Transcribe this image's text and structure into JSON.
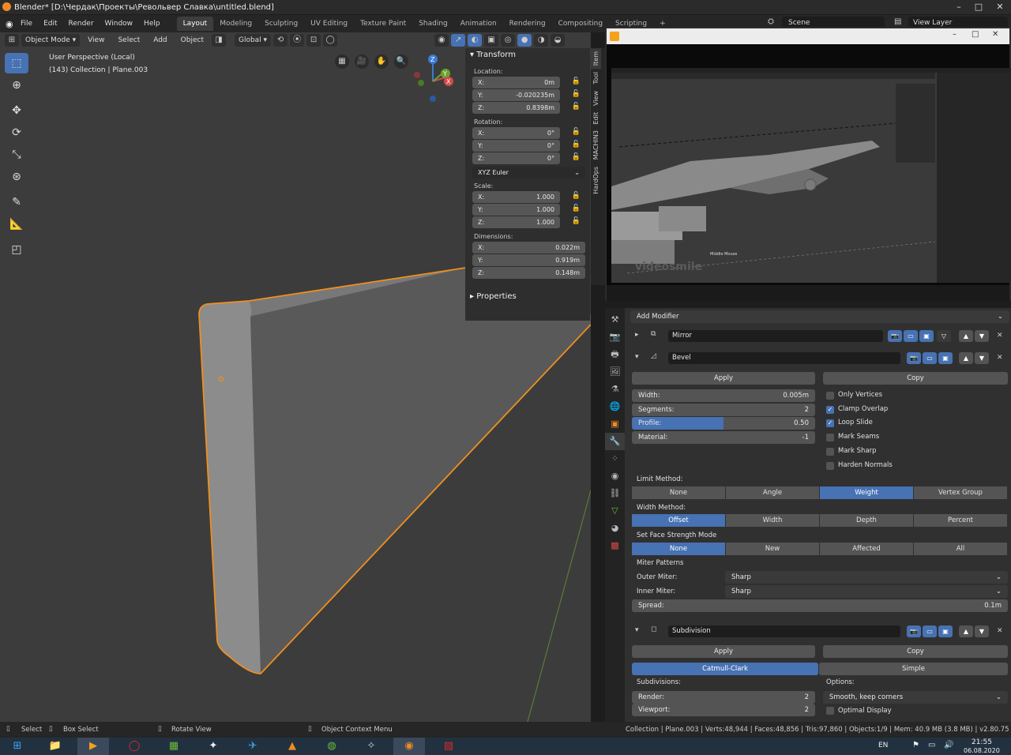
{
  "window": {
    "title": "Blender* [D:\\Чердак\\Проекты\\Револьвер Славка\\untitled.blend]"
  },
  "menu": {
    "items": [
      "File",
      "Edit",
      "Render",
      "Window",
      "Help"
    ]
  },
  "workspaces": [
    "Layout",
    "Modeling",
    "Sculpting",
    "UV Editing",
    "Texture Paint",
    "Shading",
    "Animation",
    "Rendering",
    "Compositing",
    "Scripting"
  ],
  "topright": {
    "scene": "Scene",
    "view_layer": "View Layer"
  },
  "viewport": {
    "mode": "Object Mode",
    "menus": [
      "View",
      "Select",
      "Add",
      "Object"
    ],
    "orientation": "Global",
    "overlay_line1": "User Perspective (Local)",
    "overlay_line2": "(143) Collection | Plane.003",
    "gizmo": {
      "x": "X",
      "y": "Y",
      "z": "Z"
    }
  },
  "npanel": {
    "tabs": [
      "Item",
      "Tool",
      "View",
      "Edit",
      "MACHIN3",
      "HardOps"
    ],
    "transform_title": "Transform",
    "location_label": "Location:",
    "location": [
      {
        "axis": "X:",
        "value": "0m"
      },
      {
        "axis": "Y:",
        "value": "-0.020235m"
      },
      {
        "axis": "Z:",
        "value": "0.8398m"
      }
    ],
    "rotation_label": "Rotation:",
    "rotation": [
      {
        "axis": "X:",
        "value": "0°"
      },
      {
        "axis": "Y:",
        "value": "0°"
      },
      {
        "axis": "Z:",
        "value": "0°"
      }
    ],
    "rotation_mode": "XYZ Euler",
    "scale_label": "Scale:",
    "scale": [
      {
        "axis": "X:",
        "value": "1.000"
      },
      {
        "axis": "Y:",
        "value": "1.000"
      },
      {
        "axis": "Z:",
        "value": "1.000"
      }
    ],
    "dimensions_label": "Dimensions:",
    "dimensions": [
      {
        "axis": "X:",
        "value": "0.022m"
      },
      {
        "axis": "Y:",
        "value": "0.919m"
      },
      {
        "axis": "Z:",
        "value": "0.148m"
      }
    ],
    "properties_title": "Properties"
  },
  "player": {
    "watermark": "videosmile",
    "hint": "Middle Mouse"
  },
  "modifiers": {
    "add_label": "Add Modifier",
    "mirror_name": "Mirror",
    "bevel_name": "Bevel",
    "apply": "Apply",
    "copy": "Copy",
    "width_label": "Width:",
    "width_value": "0.005m",
    "segments_label": "Segments:",
    "segments_value": "2",
    "profile_label": "Profile:",
    "profile_value": "0.50",
    "profile_fraction": 0.5,
    "material_label": "Material:",
    "material_value": "-1",
    "checks": [
      {
        "label": "Only Vertices",
        "on": false
      },
      {
        "label": "Clamp Overlap",
        "on": true
      },
      {
        "label": "Loop Slide",
        "on": true
      },
      {
        "label": "Mark Seams",
        "on": false
      },
      {
        "label": "Mark Sharp",
        "on": false
      },
      {
        "label": "Harden Normals",
        "on": false
      }
    ],
    "limit_label": "Limit Method:",
    "limit_options": [
      "None",
      "Angle",
      "Weight",
      "Vertex Group"
    ],
    "limit_selected": 2,
    "widthmethod_label": "Width Method:",
    "widthmethod_options": [
      "Offset",
      "Width",
      "Depth",
      "Percent"
    ],
    "widthmethod_selected": 0,
    "facestrength_label": "Set Face Strength Mode",
    "facestrength_options": [
      "None",
      "New",
      "Affected",
      "All"
    ],
    "facestrength_selected": 0,
    "miter_label": "Miter Patterns",
    "outer_label": "Outer Miter:",
    "outer_value": "Sharp",
    "inner_label": "Inner Miter:",
    "inner_value": "Sharp",
    "spread_label": "Spread:",
    "spread_value": "0.1m",
    "subsurf_name": "Subdivision",
    "subsurf_types": [
      "Catmull-Clark",
      "Simple"
    ],
    "subdivisions_label": "Subdivisions:",
    "render_label": "Render:",
    "render_value": "2",
    "viewport_label": "Viewport:",
    "viewport_value": "2",
    "options_label": "Options:",
    "smooth_value": "Smooth, keep corners",
    "optimal_label": "Optimal Display"
  },
  "status": {
    "select": "Select",
    "box_select": "Box Select",
    "rotate_view": "Rotate View",
    "context_menu": "Object Context Menu",
    "stats": "Collection | Plane.003 | Verts:48,944 | Faces:48,856 | Tris:97,860 | Objects:1/9 | Mem: 40.9 MB (3.8 MB) | v2.80.75"
  },
  "taskbar": {
    "lang": "EN",
    "time": "21:55",
    "date": "06.08.2020"
  },
  "colors": {
    "accent": "#4772b3",
    "selection": "#f0901e",
    "panel": "#303030"
  }
}
